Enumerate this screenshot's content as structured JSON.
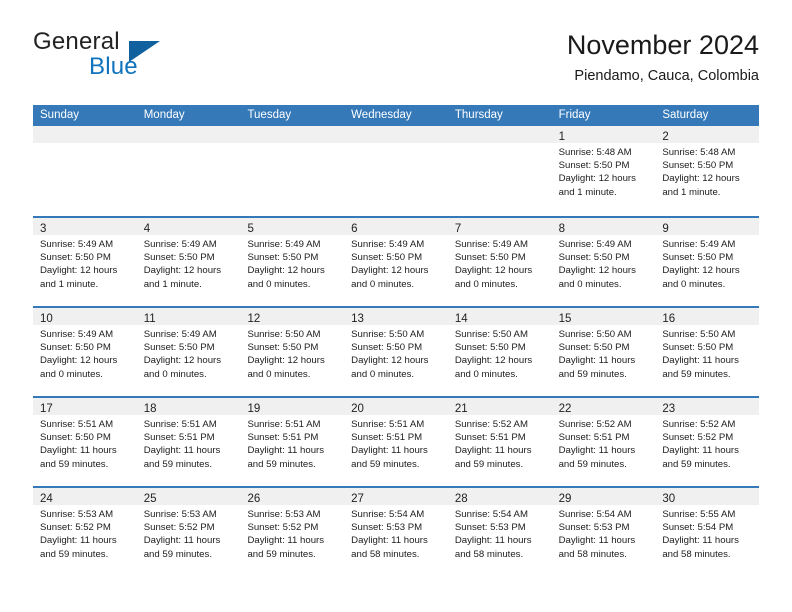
{
  "brand": {
    "word1": "General",
    "word2": "Blue",
    "triangle_color": "#12619f",
    "blue_color": "#1073bd"
  },
  "header": {
    "title": "November 2024",
    "subtitle": "Piendamo, Cauca, Colombia"
  },
  "theme": {
    "header_blue": "#3579b9",
    "daynum_band": "#f0f0f0",
    "text": "#1c1c1c"
  },
  "weekdays": [
    "Sunday",
    "Monday",
    "Tuesday",
    "Wednesday",
    "Thursday",
    "Friday",
    "Saturday"
  ],
  "weeks": [
    [
      {
        "day": "",
        "lines": []
      },
      {
        "day": "",
        "lines": []
      },
      {
        "day": "",
        "lines": []
      },
      {
        "day": "",
        "lines": []
      },
      {
        "day": "",
        "lines": []
      },
      {
        "day": "1",
        "lines": [
          "Sunrise: 5:48 AM",
          "Sunset: 5:50 PM",
          "Daylight: 12 hours",
          "and 1 minute."
        ]
      },
      {
        "day": "2",
        "lines": [
          "Sunrise: 5:48 AM",
          "Sunset: 5:50 PM",
          "Daylight: 12 hours",
          "and 1 minute."
        ]
      }
    ],
    [
      {
        "day": "3",
        "lines": [
          "Sunrise: 5:49 AM",
          "Sunset: 5:50 PM",
          "Daylight: 12 hours",
          "and 1 minute."
        ]
      },
      {
        "day": "4",
        "lines": [
          "Sunrise: 5:49 AM",
          "Sunset: 5:50 PM",
          "Daylight: 12 hours",
          "and 1 minute."
        ]
      },
      {
        "day": "5",
        "lines": [
          "Sunrise: 5:49 AM",
          "Sunset: 5:50 PM",
          "Daylight: 12 hours",
          "and 0 minutes."
        ]
      },
      {
        "day": "6",
        "lines": [
          "Sunrise: 5:49 AM",
          "Sunset: 5:50 PM",
          "Daylight: 12 hours",
          "and 0 minutes."
        ]
      },
      {
        "day": "7",
        "lines": [
          "Sunrise: 5:49 AM",
          "Sunset: 5:50 PM",
          "Daylight: 12 hours",
          "and 0 minutes."
        ]
      },
      {
        "day": "8",
        "lines": [
          "Sunrise: 5:49 AM",
          "Sunset: 5:50 PM",
          "Daylight: 12 hours",
          "and 0 minutes."
        ]
      },
      {
        "day": "9",
        "lines": [
          "Sunrise: 5:49 AM",
          "Sunset: 5:50 PM",
          "Daylight: 12 hours",
          "and 0 minutes."
        ]
      }
    ],
    [
      {
        "day": "10",
        "lines": [
          "Sunrise: 5:49 AM",
          "Sunset: 5:50 PM",
          "Daylight: 12 hours",
          "and 0 minutes."
        ]
      },
      {
        "day": "11",
        "lines": [
          "Sunrise: 5:49 AM",
          "Sunset: 5:50 PM",
          "Daylight: 12 hours",
          "and 0 minutes."
        ]
      },
      {
        "day": "12",
        "lines": [
          "Sunrise: 5:50 AM",
          "Sunset: 5:50 PM",
          "Daylight: 12 hours",
          "and 0 minutes."
        ]
      },
      {
        "day": "13",
        "lines": [
          "Sunrise: 5:50 AM",
          "Sunset: 5:50 PM",
          "Daylight: 12 hours",
          "and 0 minutes."
        ]
      },
      {
        "day": "14",
        "lines": [
          "Sunrise: 5:50 AM",
          "Sunset: 5:50 PM",
          "Daylight: 12 hours",
          "and 0 minutes."
        ]
      },
      {
        "day": "15",
        "lines": [
          "Sunrise: 5:50 AM",
          "Sunset: 5:50 PM",
          "Daylight: 11 hours",
          "and 59 minutes."
        ]
      },
      {
        "day": "16",
        "lines": [
          "Sunrise: 5:50 AM",
          "Sunset: 5:50 PM",
          "Daylight: 11 hours",
          "and 59 minutes."
        ]
      }
    ],
    [
      {
        "day": "17",
        "lines": [
          "Sunrise: 5:51 AM",
          "Sunset: 5:50 PM",
          "Daylight: 11 hours",
          "and 59 minutes."
        ]
      },
      {
        "day": "18",
        "lines": [
          "Sunrise: 5:51 AM",
          "Sunset: 5:51 PM",
          "Daylight: 11 hours",
          "and 59 minutes."
        ]
      },
      {
        "day": "19",
        "lines": [
          "Sunrise: 5:51 AM",
          "Sunset: 5:51 PM",
          "Daylight: 11 hours",
          "and 59 minutes."
        ]
      },
      {
        "day": "20",
        "lines": [
          "Sunrise: 5:51 AM",
          "Sunset: 5:51 PM",
          "Daylight: 11 hours",
          "and 59 minutes."
        ]
      },
      {
        "day": "21",
        "lines": [
          "Sunrise: 5:52 AM",
          "Sunset: 5:51 PM",
          "Daylight: 11 hours",
          "and 59 minutes."
        ]
      },
      {
        "day": "22",
        "lines": [
          "Sunrise: 5:52 AM",
          "Sunset: 5:51 PM",
          "Daylight: 11 hours",
          "and 59 minutes."
        ]
      },
      {
        "day": "23",
        "lines": [
          "Sunrise: 5:52 AM",
          "Sunset: 5:52 PM",
          "Daylight: 11 hours",
          "and 59 minutes."
        ]
      }
    ],
    [
      {
        "day": "24",
        "lines": [
          "Sunrise: 5:53 AM",
          "Sunset: 5:52 PM",
          "Daylight: 11 hours",
          "and 59 minutes."
        ]
      },
      {
        "day": "25",
        "lines": [
          "Sunrise: 5:53 AM",
          "Sunset: 5:52 PM",
          "Daylight: 11 hours",
          "and 59 minutes."
        ]
      },
      {
        "day": "26",
        "lines": [
          "Sunrise: 5:53 AM",
          "Sunset: 5:52 PM",
          "Daylight: 11 hours",
          "and 59 minutes."
        ]
      },
      {
        "day": "27",
        "lines": [
          "Sunrise: 5:54 AM",
          "Sunset: 5:53 PM",
          "Daylight: 11 hours",
          "and 58 minutes."
        ]
      },
      {
        "day": "28",
        "lines": [
          "Sunrise: 5:54 AM",
          "Sunset: 5:53 PM",
          "Daylight: 11 hours",
          "and 58 minutes."
        ]
      },
      {
        "day": "29",
        "lines": [
          "Sunrise: 5:54 AM",
          "Sunset: 5:53 PM",
          "Daylight: 11 hours",
          "and 58 minutes."
        ]
      },
      {
        "day": "30",
        "lines": [
          "Sunrise: 5:55 AM",
          "Sunset: 5:54 PM",
          "Daylight: 11 hours",
          "and 58 minutes."
        ]
      }
    ]
  ]
}
